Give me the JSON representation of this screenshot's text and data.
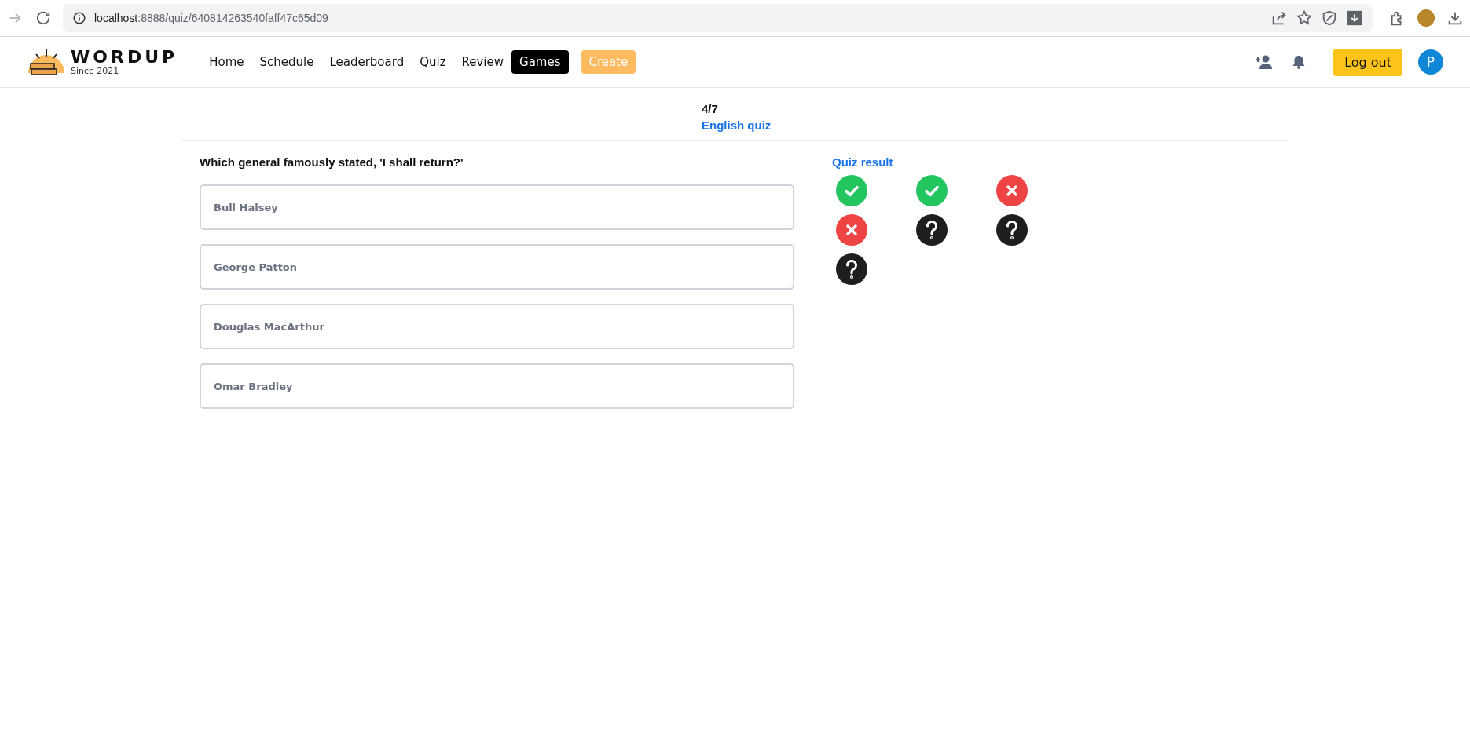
{
  "browser": {
    "url_host": "localhost",
    "url_path": ":8888/quiz/640814263540faff47c65d09"
  },
  "brand": {
    "name": "WORDUP",
    "tagline": "Since 2021"
  },
  "nav": [
    {
      "label": "Home",
      "kind": "link",
      "selected": false
    },
    {
      "label": "Schedule",
      "kind": "link",
      "selected": false
    },
    {
      "label": "Leaderboard",
      "kind": "link",
      "selected": false
    },
    {
      "label": "Quiz",
      "kind": "link",
      "selected": false
    },
    {
      "label": "Review",
      "kind": "link",
      "selected": false
    },
    {
      "label": "Games",
      "kind": "pill",
      "selected": true
    },
    {
      "label": "Create",
      "kind": "accent",
      "selected": false
    }
  ],
  "user": {
    "logout": "Log out",
    "avatar": "P"
  },
  "quiz": {
    "question_count": "4/7",
    "title": "English quiz"
  },
  "question": "Which general famously stated, 'I shall return?'",
  "options": [
    {
      "label": "Bull Halsey"
    },
    {
      "label": "George Patton"
    },
    {
      "label": "Douglas MacArthur"
    },
    {
      "label": "Omar Bradley"
    }
  ],
  "result": {
    "title": "Quiz result",
    "items": [
      {
        "kind": "correct"
      },
      {
        "kind": "correct"
      },
      {
        "kind": "wrong"
      },
      {
        "kind": "wrong"
      },
      {
        "kind": "unanswered"
      },
      {
        "kind": "unanswered"
      },
      {
        "kind": "unanswered"
      }
    ]
  }
}
